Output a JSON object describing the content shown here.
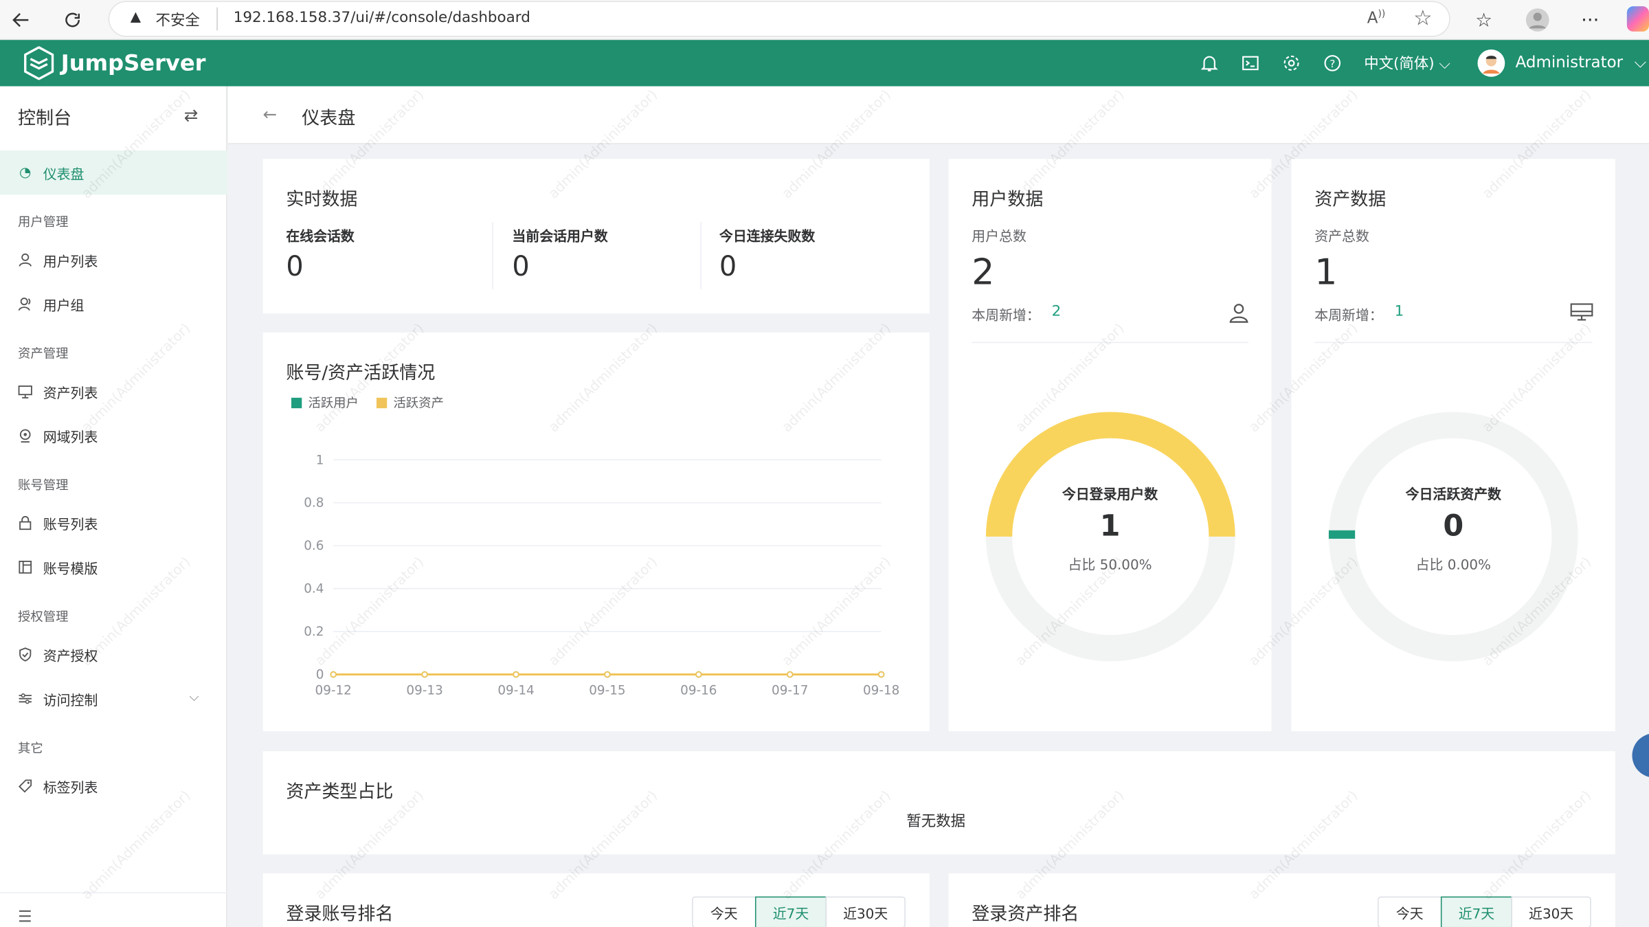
{
  "browser": {
    "security_label": "不安全",
    "url": "192.168.158.37/ui/#/console/dashboard"
  },
  "topnav": {
    "logo": "JumpServer",
    "language": "中文(简体)",
    "user": "Administrator"
  },
  "sidebar": {
    "title": "控制台",
    "items": {
      "dashboard": "仪表盘",
      "user_list": "用户列表",
      "user_group": "用户组",
      "asset_list": "资产列表",
      "domain_list": "网域列表",
      "account_list": "账号列表",
      "account_template": "账号模版",
      "asset_perm": "资产授权",
      "acl": "访问控制",
      "label_list": "标签列表"
    },
    "groups": {
      "user_mgmt": "用户管理",
      "asset_mgmt": "资产管理",
      "account_mgmt": "账号管理",
      "perm_mgmt": "授权管理",
      "other": "其它"
    }
  },
  "page": {
    "title": "仪表盘"
  },
  "realtime": {
    "title": "实时数据",
    "online_sessions_label": "在线会话数",
    "online_sessions": "0",
    "session_users_label": "当前会话用户数",
    "session_users": "0",
    "failed_label": "今日连接失败数",
    "failed": "0"
  },
  "user_data": {
    "title": "用户数据",
    "total_label": "用户总数",
    "total": "2",
    "weekly_label": "本周新增：",
    "weekly": "2",
    "gauge_title": "今日登录用户数",
    "gauge_value": "1",
    "gauge_ratio": "占比 50.00%",
    "ratio": 0.5,
    "color": "#f9d45c"
  },
  "asset_data": {
    "title": "资产数据",
    "total_label": "资产总数",
    "total": "1",
    "weekly_label": "本周新增：",
    "weekly": "1",
    "gauge_title": "今日活跃资产数",
    "gauge_value": "0",
    "gauge_ratio": "占比 0.00%",
    "ratio": 0.0,
    "color": "#1f9e7f"
  },
  "activity": {
    "title": "账号/资产活跃情况"
  },
  "chart_data": {
    "type": "line",
    "title": "账号/资产活跃情况",
    "categories": [
      "09-12",
      "09-13",
      "09-14",
      "09-15",
      "09-16",
      "09-17",
      "09-18"
    ],
    "series": [
      {
        "name": "活跃用户",
        "color": "#1f9e7f",
        "values": [
          0,
          0,
          0,
          0,
          0,
          0,
          0
        ]
      },
      {
        "name": "活跃资产",
        "color": "#f0c45a",
        "values": [
          0,
          0,
          0,
          0,
          0,
          0,
          0
        ]
      }
    ],
    "yticks": [
      "1",
      "0.8",
      "0.6",
      "0.4",
      "0.2",
      "0"
    ],
    "ylim": [
      0,
      1
    ],
    "grid": true,
    "legend": "top-left"
  },
  "asset_type": {
    "title": "资产类型占比",
    "empty": "暂无数据"
  },
  "login_account_rank": {
    "title": "登录账号排名",
    "tabs": [
      "今天",
      "近7天",
      "近30天"
    ]
  },
  "login_asset_rank": {
    "title": "登录资产排名",
    "tabs": [
      "今天",
      "近7天",
      "近30天"
    ]
  },
  "watermark": "admin(Administrator)"
}
